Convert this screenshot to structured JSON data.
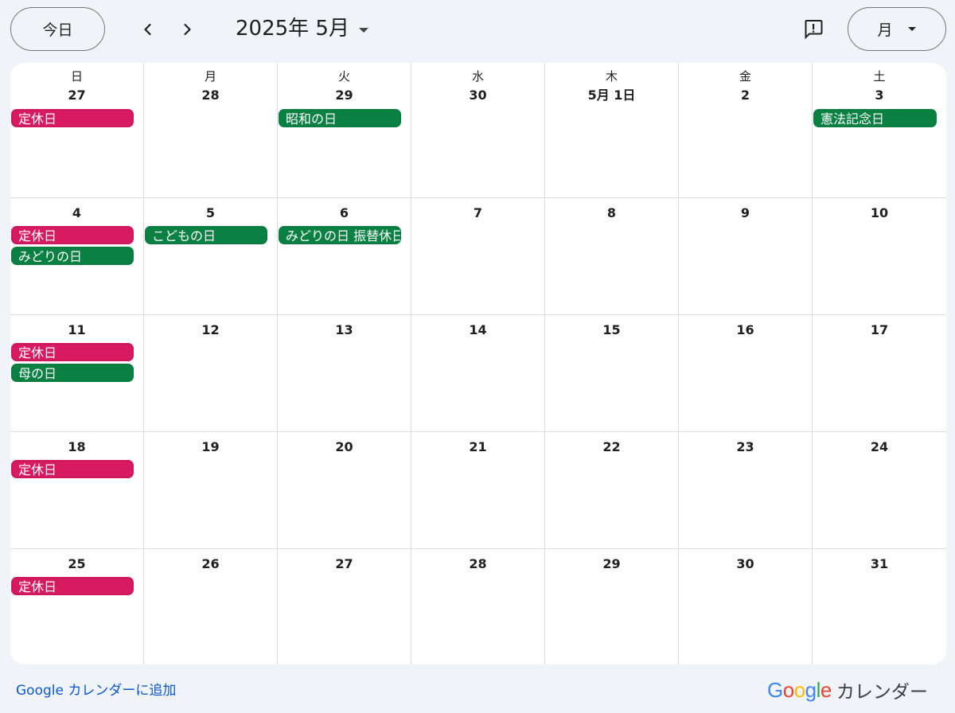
{
  "toolbar": {
    "today_label": "今日",
    "month_title": "2025年 5月",
    "view_label": "月",
    "prev_icon": "chevron-left-icon",
    "next_icon": "chevron-right-icon",
    "feedback_icon": "feedback-icon"
  },
  "colors": {
    "red": "#d81b60",
    "green": "#0b8043",
    "link": "#0b57d0"
  },
  "weekdays": [
    "日",
    "月",
    "火",
    "水",
    "木",
    "金",
    "土"
  ],
  "weeks": [
    [
      {
        "day": "27",
        "events": [
          {
            "title": "定休日",
            "color": "red"
          }
        ]
      },
      {
        "day": "28",
        "events": []
      },
      {
        "day": "29",
        "events": [
          {
            "title": "昭和の日",
            "color": "green"
          }
        ]
      },
      {
        "day": "30",
        "events": []
      },
      {
        "day": "5月 1日",
        "events": []
      },
      {
        "day": "2",
        "events": []
      },
      {
        "day": "3",
        "events": [
          {
            "title": "憲法記念日",
            "color": "green"
          }
        ]
      }
    ],
    [
      {
        "day": "4",
        "events": [
          {
            "title": "定休日",
            "color": "red"
          },
          {
            "title": "みどりの日",
            "color": "green"
          }
        ]
      },
      {
        "day": "5",
        "events": [
          {
            "title": "こどもの日",
            "color": "green"
          }
        ]
      },
      {
        "day": "6",
        "events": [
          {
            "title": "みどりの日 振替休日",
            "color": "green"
          }
        ]
      },
      {
        "day": "7",
        "events": []
      },
      {
        "day": "8",
        "events": []
      },
      {
        "day": "9",
        "events": []
      },
      {
        "day": "10",
        "events": []
      }
    ],
    [
      {
        "day": "11",
        "events": [
          {
            "title": "定休日",
            "color": "red"
          },
          {
            "title": "母の日",
            "color": "green"
          }
        ]
      },
      {
        "day": "12",
        "events": []
      },
      {
        "day": "13",
        "events": []
      },
      {
        "day": "14",
        "events": []
      },
      {
        "day": "15",
        "events": []
      },
      {
        "day": "16",
        "events": []
      },
      {
        "day": "17",
        "events": []
      }
    ],
    [
      {
        "day": "18",
        "events": [
          {
            "title": "定休日",
            "color": "red"
          }
        ]
      },
      {
        "day": "19",
        "events": []
      },
      {
        "day": "20",
        "events": []
      },
      {
        "day": "21",
        "events": []
      },
      {
        "day": "22",
        "events": []
      },
      {
        "day": "23",
        "events": []
      },
      {
        "day": "24",
        "events": []
      }
    ],
    [
      {
        "day": "25",
        "events": [
          {
            "title": "定休日",
            "color": "red"
          }
        ]
      },
      {
        "day": "26",
        "events": []
      },
      {
        "day": "27",
        "events": []
      },
      {
        "day": "28",
        "events": []
      },
      {
        "day": "29",
        "events": []
      },
      {
        "day": "30",
        "events": []
      },
      {
        "day": "31",
        "events": []
      }
    ]
  ],
  "footer": {
    "add_link": "Google カレンダーに追加",
    "brand_logo": "Google",
    "brand_text": "カレンダー"
  }
}
